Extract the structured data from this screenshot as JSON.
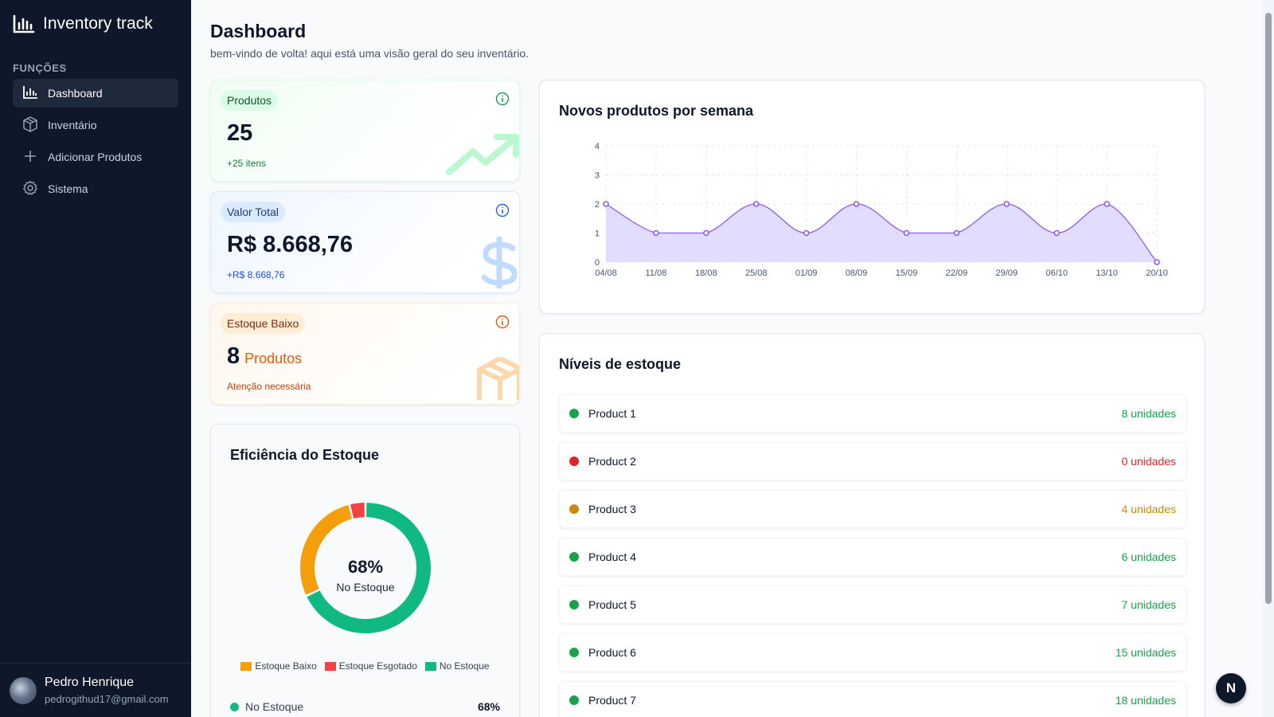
{
  "app": {
    "brand": "Inventory track",
    "brand_icon": "bar-chart-icon"
  },
  "sidebar": {
    "section_label": "FUNÇÕES",
    "items": [
      {
        "label": "Dashboard",
        "icon": "bar-chart-icon",
        "active": true
      },
      {
        "label": "Inventário",
        "icon": "box-icon",
        "active": false
      },
      {
        "label": "Adicionar Produtos",
        "icon": "plus-icon",
        "active": false
      },
      {
        "label": "Sistema",
        "icon": "gear-icon",
        "active": false
      }
    ],
    "user": {
      "name": "Pedro Henrique",
      "email": "pedrogithud17@gmail.com"
    }
  },
  "header": {
    "title": "Dashboard",
    "subtitle": "bem-vindo de volta! aqui está uma visão geral do seu inventário."
  },
  "stats": {
    "produtos": {
      "label": "Produtos",
      "value": "25",
      "sub": "+25 itens",
      "color": "#16a34a"
    },
    "valor": {
      "label": "Valor Total",
      "value": "R$ 8.668,76",
      "sub": "+R$ 8.668,76",
      "color": "#2563eb"
    },
    "estoque_baixo": {
      "label": "Estoque Baixo",
      "value": "8",
      "unit": "Produtos",
      "sub": "Atenção necessária",
      "color": "#ea580c"
    }
  },
  "efficiency": {
    "title": "Eficiência do Estoque",
    "center_value": "68%",
    "center_label": "No Estoque",
    "segments": [
      {
        "label": "Estoque Baixo",
        "pct": 28,
        "color": "#f59e0b"
      },
      {
        "label": "Estoque Esgotado",
        "pct": 4,
        "color": "#ef4444"
      },
      {
        "label": "No Estoque",
        "pct": 68,
        "color": "#10b981"
      }
    ],
    "row": {
      "label": "No Estoque",
      "value": "68%"
    }
  },
  "chart_data": {
    "type": "area",
    "title": "Novos produtos por semana",
    "categories": [
      "04/08",
      "11/08",
      "18/08",
      "25/08",
      "01/09",
      "08/09",
      "15/09",
      "22/09",
      "29/09",
      "06/10",
      "13/10",
      "20/10"
    ],
    "values": [
      2,
      1,
      1,
      2,
      1,
      2,
      1,
      1,
      2,
      1,
      2,
      0
    ],
    "ylim": [
      0,
      4
    ],
    "yticks": [
      "0",
      "1",
      "2",
      "3",
      "4"
    ],
    "grid": true,
    "xlabel": "",
    "ylabel": "",
    "color": "#8b5cf6"
  },
  "stock": {
    "title": "Níveis de estoque",
    "items": [
      {
        "name": "Product 1",
        "qty": "8 unidades",
        "color": "#16a34a"
      },
      {
        "name": "Product 2",
        "qty": "0 unidades",
        "color": "#dc2626"
      },
      {
        "name": "Product 3",
        "qty": "4 unidades",
        "color": "#ca8a04"
      },
      {
        "name": "Product 4",
        "qty": "6 unidades",
        "color": "#16a34a"
      },
      {
        "name": "Product 5",
        "qty": "7 unidades",
        "color": "#16a34a"
      },
      {
        "name": "Product 6",
        "qty": "15 unidades",
        "color": "#16a34a"
      },
      {
        "name": "Product 7",
        "qty": "18 unidades",
        "color": "#16a34a"
      }
    ]
  },
  "fab": {
    "label": "N"
  }
}
